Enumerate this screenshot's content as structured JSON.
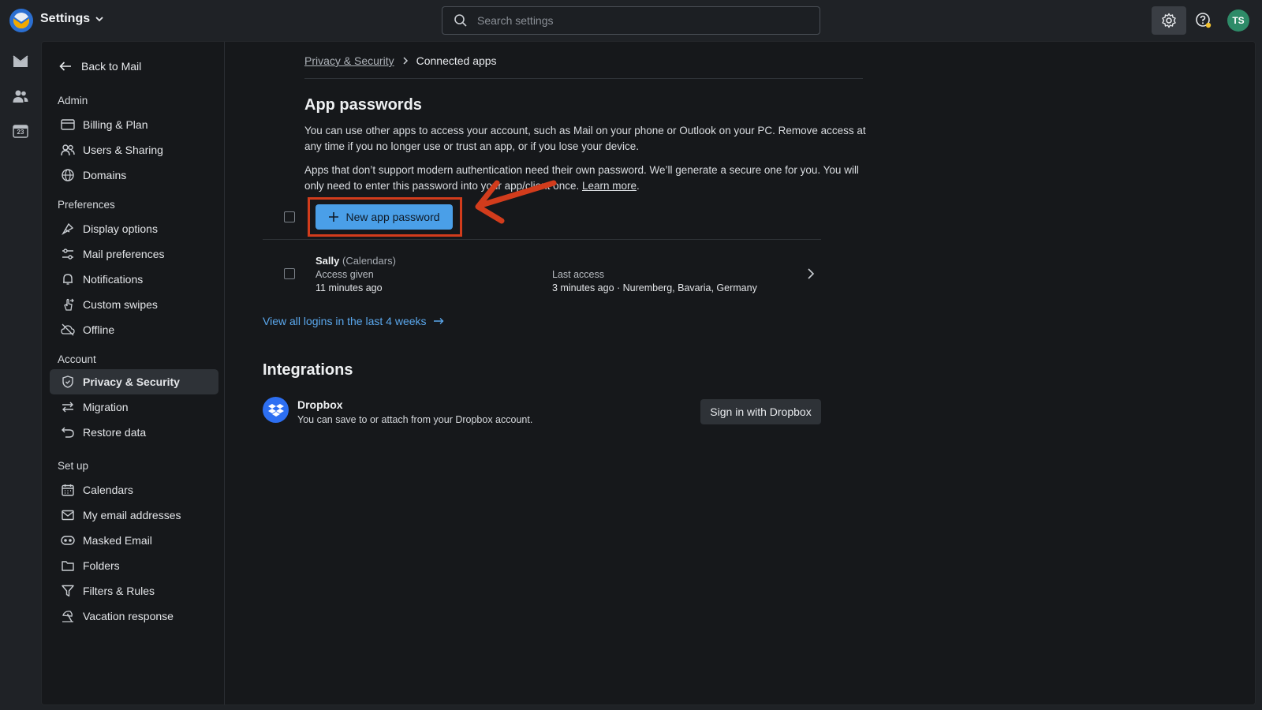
{
  "app": {
    "title": "Settings"
  },
  "search": {
    "placeholder": "Search settings"
  },
  "user": {
    "initials": "TS"
  },
  "rail": {
    "calendar_day": "23"
  },
  "sidebar": {
    "back": "Back to Mail",
    "groups": [
      {
        "heading": "Admin",
        "items": [
          {
            "label": "Billing & Plan",
            "icon": "card-icon"
          },
          {
            "label": "Users & Sharing",
            "icon": "users-icon"
          },
          {
            "label": "Domains",
            "icon": "globe-icon"
          }
        ]
      },
      {
        "heading": "Preferences",
        "items": [
          {
            "label": "Display options",
            "icon": "paint-icon"
          },
          {
            "label": "Mail preferences",
            "icon": "sliders-icon"
          },
          {
            "label": "Notifications",
            "icon": "bell-icon"
          },
          {
            "label": "Custom swipes",
            "icon": "swipe-icon"
          },
          {
            "label": "Offline",
            "icon": "cloud-off-icon"
          }
        ]
      },
      {
        "heading": "Account",
        "items": [
          {
            "label": "Privacy & Security",
            "icon": "shield-icon",
            "active": true
          },
          {
            "label": "Migration",
            "icon": "migrate-icon"
          },
          {
            "label": "Restore data",
            "icon": "undo-icon"
          }
        ]
      },
      {
        "heading": "Set up",
        "items": [
          {
            "label": "Calendars",
            "icon": "calendar-icon"
          },
          {
            "label": "My email addresses",
            "icon": "envelope-icon"
          },
          {
            "label": "Masked Email",
            "icon": "mask-icon"
          },
          {
            "label": "Folders",
            "icon": "folder-icon"
          },
          {
            "label": "Filters & Rules",
            "icon": "filter-icon"
          },
          {
            "label": "Vacation response",
            "icon": "beach-icon"
          }
        ]
      }
    ]
  },
  "breadcrumb": {
    "parent": "Privacy & Security",
    "current": "Connected apps"
  },
  "app_passwords": {
    "title": "App passwords",
    "para1": "You can use other apps to access your account, such as Mail on your phone or Outlook on your PC. Remove access at any time if you no longer use or trust an app, or if you lose your device.",
    "para2_before": "Apps that don’t support modern authentication need their own password. We’ll generate a secure one for you. You will only need to enter this password into your app/client once. ",
    "learn_more": "Learn more",
    "para2_after": ".",
    "new_button": "New app password",
    "rows": [
      {
        "name": "Sally",
        "tag": "(Calendars)",
        "status": "Access given",
        "time": "11 minutes ago",
        "last_access_label": "Last access",
        "last_access": "3 minutes ago · Nuremberg, Bavaria, Germany"
      }
    ],
    "view_all": "View all logins in the last 4 weeks"
  },
  "integrations": {
    "title": "Integrations",
    "items": [
      {
        "name": "Dropbox",
        "description": "You can save to or attach from your Dropbox account.",
        "button": "Sign in with Dropbox"
      }
    ]
  },
  "colors": {
    "accent": "#4a9fe8",
    "highlight": "#d23c1c",
    "link": "#5aa7ec",
    "dropbox": "#2d6ff2",
    "avatar": "#2e8b68"
  }
}
